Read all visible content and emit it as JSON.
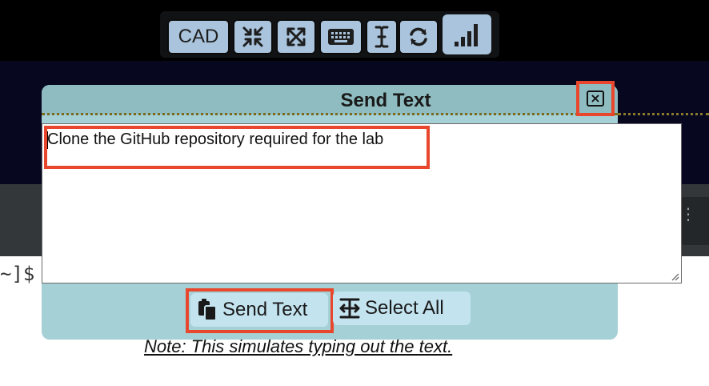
{
  "toolbar": {
    "cad_label": "CAD",
    "buttons": [
      {
        "icon": "exit-fullscreen-icon"
      },
      {
        "icon": "fullscreen-icon"
      },
      {
        "icon": "keyboard-icon"
      },
      {
        "icon": "text-cursor-icon"
      },
      {
        "icon": "refresh-icon"
      },
      {
        "icon": "signal-strength-icon"
      }
    ]
  },
  "terminal": {
    "prompt": "~]$"
  },
  "modal": {
    "title": "Send Text",
    "text_value": "Clone the GitHub repository required for the lab",
    "send_label": "Send Text",
    "select_all_label": "Select All",
    "note": "Note: This simulates typing out the text."
  },
  "colors": {
    "modal_bg": "#a5d0d6",
    "modal_header_bg": "#8fbcc0",
    "highlight": "#e8472d",
    "toolbar_button": "#a9c4dc",
    "button_bg": "#c3e3ef"
  }
}
